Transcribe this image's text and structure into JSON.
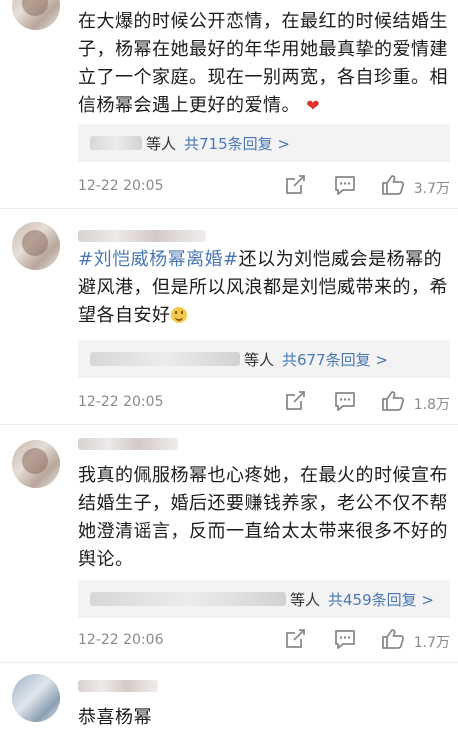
{
  "comments": [
    {
      "text_parts": [
        "在大爆的时候公开恋情，在最红的时候结婚生子，杨幂在她最好的年华用她最真挚的爱情建立了一个家庭。现在一别两宽，各自珍重。相信杨幂会遇上更好的爱情。"
      ],
      "reply_suffix": "等人",
      "reply_count": "共715条回复 >",
      "time": "12-22 20:05",
      "likes": "3.7万"
    },
    {
      "hashtag": "#刘恺威杨幂离婚#",
      "text": "还以为刘恺威会是杨幂的避风港，但是所以风浪都是刘恺威带来的，希望各自安好",
      "reply_suffix": "等人",
      "reply_count": "共677条回复 >",
      "time": "12-22 20:05",
      "likes": "1.8万"
    },
    {
      "text": "我真的佩服杨幂也心疼她，在最火的时候宣布结婚生子，婚后还要赚钱养家，老公不仅不帮她澄清谣言，反而一直给太太带来很多不好的舆论。",
      "reply_suffix": "等人",
      "reply_count": "共459条回复 >",
      "time": "12-22 20:06",
      "likes": "1.7万"
    },
    {
      "text": "恭喜杨幂"
    }
  ],
  "icons": {
    "share": "share-icon",
    "comment": "comment-icon",
    "like": "thumb-up-icon",
    "heart": "heart-emoji",
    "smile": "smile-emoji"
  },
  "colors": {
    "link": "#4a78b7",
    "meta": "#8a8a8a",
    "reply_bg": "#f3f3f3",
    "heart": "#e0332f"
  }
}
